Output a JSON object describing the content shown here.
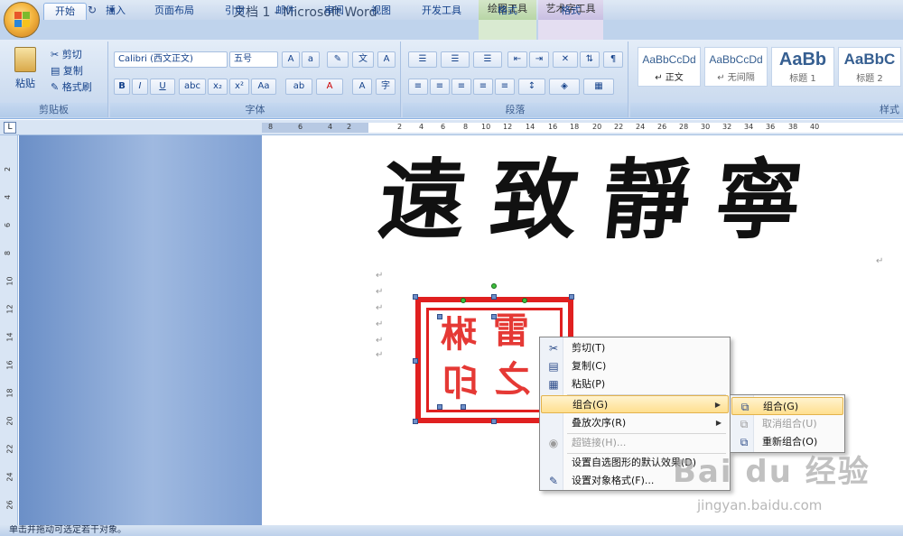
{
  "titlebar": {
    "doc_title": "文档 1 - Microsoft Word",
    "context_tab_drawing": "绘图工具",
    "context_tab_wordart": "艺术字工具",
    "qat_icons": [
      "save-icon",
      "undo-icon",
      "redo-icon",
      "customize-icon"
    ]
  },
  "tabs": [
    "开始",
    "插入",
    "页面布局",
    "引用",
    "邮件",
    "审阅",
    "视图",
    "开发工具",
    "格式",
    "格式"
  ],
  "ribbon": {
    "clipboard": {
      "paste": "粘贴",
      "cut": "剪切",
      "copy": "复制",
      "format_painter": "格式刷",
      "label": "剪贴板"
    },
    "font": {
      "font_name": "Calibri (西文正文)",
      "font_size": "五号",
      "label": "字体"
    },
    "paragraph": {
      "label": "段落"
    },
    "styles": {
      "items": [
        {
          "sample": "AaBbCcDd",
          "name": "↵ 正文"
        },
        {
          "sample": "AaBbCcDd",
          "name": "↵ 无间隔"
        },
        {
          "sample": "AaBb",
          "name": "标题 1"
        },
        {
          "sample": "AaBbC",
          "name": "标题 2"
        }
      ],
      "label": "样式"
    }
  },
  "ruler": {
    "h_numbers": [
      "8",
      "6",
      "4",
      "2",
      "2",
      "4",
      "6",
      "8",
      "10",
      "12",
      "14",
      "16",
      "18",
      "20",
      "22",
      "24",
      "26",
      "28",
      "30",
      "32",
      "34",
      "36",
      "38",
      "40"
    ],
    "v_numbers": [
      "2",
      "4",
      "6",
      "8",
      "10",
      "12",
      "14",
      "16",
      "18",
      "20",
      "22",
      "24",
      "26"
    ],
    "tab_selector": "L"
  },
  "document": {
    "calligraphy": "遠致靜寧",
    "seal_chars": [
      "雷",
      "琳",
      "之",
      "印"
    ]
  },
  "context_menu": {
    "items": [
      {
        "label": "剪切(T)",
        "icon": "scissors-icon",
        "enabled": true
      },
      {
        "label": "复制(C)",
        "icon": "copy-icon",
        "enabled": true
      },
      {
        "label": "粘贴(P)",
        "icon": "paste-icon",
        "enabled": true
      },
      {
        "label": "组合(G)",
        "icon": "",
        "enabled": true,
        "submenu": true,
        "highlighted": true
      },
      {
        "label": "叠放次序(R)",
        "icon": "",
        "enabled": true,
        "submenu": true
      },
      {
        "label": "超链接(H)...",
        "icon": "hyperlink-icon",
        "enabled": false
      },
      {
        "label": "设置自选图形的默认效果(D)",
        "icon": "",
        "enabled": true
      },
      {
        "label": "设置对象格式(F)...",
        "icon": "format-object-icon",
        "enabled": true
      }
    ]
  },
  "submenu": {
    "items": [
      {
        "label": "组合(G)",
        "icon": "group-icon",
        "enabled": true,
        "highlighted": true
      },
      {
        "label": "取消组合(U)",
        "icon": "ungroup-icon",
        "enabled": false
      },
      {
        "label": "重新组合(O)",
        "icon": "regroup-icon",
        "enabled": true
      }
    ]
  },
  "watermark": {
    "brand": "Bai du 经验",
    "url": "jingyan.baidu.com"
  },
  "status": {
    "text": "单击并拖动可选定若干对象。"
  }
}
